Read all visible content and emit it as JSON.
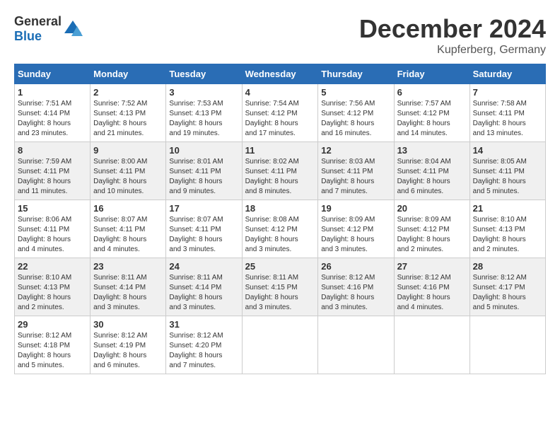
{
  "header": {
    "logo_general": "General",
    "logo_blue": "Blue",
    "month_title": "December 2024",
    "location": "Kupferberg, Germany"
  },
  "days_of_week": [
    "Sunday",
    "Monday",
    "Tuesday",
    "Wednesday",
    "Thursday",
    "Friday",
    "Saturday"
  ],
  "weeks": [
    [
      {
        "day": "1",
        "sunrise": "7:51 AM",
        "sunset": "4:14 PM",
        "daylight": "8 hours and 23 minutes."
      },
      {
        "day": "2",
        "sunrise": "7:52 AM",
        "sunset": "4:13 PM",
        "daylight": "8 hours and 21 minutes."
      },
      {
        "day": "3",
        "sunrise": "7:53 AM",
        "sunset": "4:13 PM",
        "daylight": "8 hours and 19 minutes."
      },
      {
        "day": "4",
        "sunrise": "7:54 AM",
        "sunset": "4:12 PM",
        "daylight": "8 hours and 17 minutes."
      },
      {
        "day": "5",
        "sunrise": "7:56 AM",
        "sunset": "4:12 PM",
        "daylight": "8 hours and 16 minutes."
      },
      {
        "day": "6",
        "sunrise": "7:57 AM",
        "sunset": "4:12 PM",
        "daylight": "8 hours and 14 minutes."
      },
      {
        "day": "7",
        "sunrise": "7:58 AM",
        "sunset": "4:11 PM",
        "daylight": "8 hours and 13 minutes."
      }
    ],
    [
      {
        "day": "8",
        "sunrise": "7:59 AM",
        "sunset": "4:11 PM",
        "daylight": "8 hours and 11 minutes."
      },
      {
        "day": "9",
        "sunrise": "8:00 AM",
        "sunset": "4:11 PM",
        "daylight": "8 hours and 10 minutes."
      },
      {
        "day": "10",
        "sunrise": "8:01 AM",
        "sunset": "4:11 PM",
        "daylight": "8 hours and 9 minutes."
      },
      {
        "day": "11",
        "sunrise": "8:02 AM",
        "sunset": "4:11 PM",
        "daylight": "8 hours and 8 minutes."
      },
      {
        "day": "12",
        "sunrise": "8:03 AM",
        "sunset": "4:11 PM",
        "daylight": "8 hours and 7 minutes."
      },
      {
        "day": "13",
        "sunrise": "8:04 AM",
        "sunset": "4:11 PM",
        "daylight": "8 hours and 6 minutes."
      },
      {
        "day": "14",
        "sunrise": "8:05 AM",
        "sunset": "4:11 PM",
        "daylight": "8 hours and 5 minutes."
      }
    ],
    [
      {
        "day": "15",
        "sunrise": "8:06 AM",
        "sunset": "4:11 PM",
        "daylight": "8 hours and 4 minutes."
      },
      {
        "day": "16",
        "sunrise": "8:07 AM",
        "sunset": "4:11 PM",
        "daylight": "8 hours and 4 minutes."
      },
      {
        "day": "17",
        "sunrise": "8:07 AM",
        "sunset": "4:11 PM",
        "daylight": "8 hours and 3 minutes."
      },
      {
        "day": "18",
        "sunrise": "8:08 AM",
        "sunset": "4:12 PM",
        "daylight": "8 hours and 3 minutes."
      },
      {
        "day": "19",
        "sunrise": "8:09 AM",
        "sunset": "4:12 PM",
        "daylight": "8 hours and 3 minutes."
      },
      {
        "day": "20",
        "sunrise": "8:09 AM",
        "sunset": "4:12 PM",
        "daylight": "8 hours and 2 minutes."
      },
      {
        "day": "21",
        "sunrise": "8:10 AM",
        "sunset": "4:13 PM",
        "daylight": "8 hours and 2 minutes."
      }
    ],
    [
      {
        "day": "22",
        "sunrise": "8:10 AM",
        "sunset": "4:13 PM",
        "daylight": "8 hours and 2 minutes."
      },
      {
        "day": "23",
        "sunrise": "8:11 AM",
        "sunset": "4:14 PM",
        "daylight": "8 hours and 3 minutes."
      },
      {
        "day": "24",
        "sunrise": "8:11 AM",
        "sunset": "4:14 PM",
        "daylight": "8 hours and 3 minutes."
      },
      {
        "day": "25",
        "sunrise": "8:11 AM",
        "sunset": "4:15 PM",
        "daylight": "8 hours and 3 minutes."
      },
      {
        "day": "26",
        "sunrise": "8:12 AM",
        "sunset": "4:16 PM",
        "daylight": "8 hours and 3 minutes."
      },
      {
        "day": "27",
        "sunrise": "8:12 AM",
        "sunset": "4:16 PM",
        "daylight": "8 hours and 4 minutes."
      },
      {
        "day": "28",
        "sunrise": "8:12 AM",
        "sunset": "4:17 PM",
        "daylight": "8 hours and 5 minutes."
      }
    ],
    [
      {
        "day": "29",
        "sunrise": "8:12 AM",
        "sunset": "4:18 PM",
        "daylight": "8 hours and 5 minutes."
      },
      {
        "day": "30",
        "sunrise": "8:12 AM",
        "sunset": "4:19 PM",
        "daylight": "8 hours and 6 minutes."
      },
      {
        "day": "31",
        "sunrise": "8:12 AM",
        "sunset": "4:20 PM",
        "daylight": "8 hours and 7 minutes."
      },
      null,
      null,
      null,
      null
    ]
  ],
  "labels": {
    "sunrise": "Sunrise:",
    "sunset": "Sunset:",
    "daylight": "Daylight:"
  }
}
